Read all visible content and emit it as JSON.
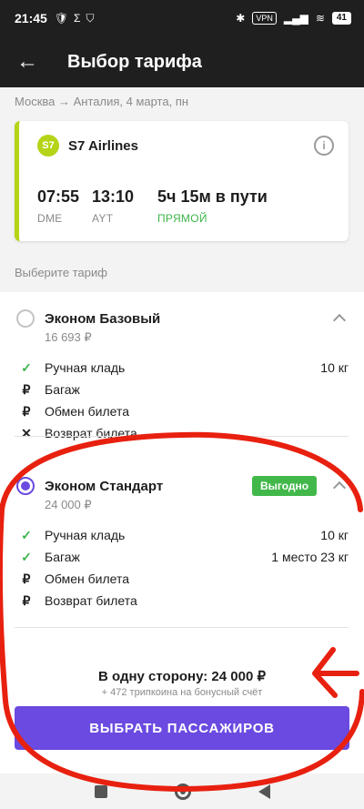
{
  "status_bar": {
    "time": "21:45",
    "vpn": "VPN",
    "battery": "41"
  },
  "header": {
    "title": "Выбор тарифа"
  },
  "route": "Москва → Анталия, 4 марта, пн",
  "flight": {
    "airline": "S7 Airlines",
    "logo_text": "S7",
    "departure_time": "07:55",
    "departure_airport": "DME",
    "arrival_time": "13:10",
    "arrival_airport": "AYT",
    "duration": "5ч 15м в пути",
    "type": "ПРЯМОЙ",
    "accent_color": "#b6d417"
  },
  "choose_label": "Выберите тариф",
  "tariffs": [
    {
      "name": "Эконом Базовый",
      "price": "16 693 ₽",
      "selected": false,
      "features": [
        {
          "icon": "check-icon",
          "label": "Ручная кладь",
          "value": "10 кг"
        },
        {
          "icon": "ruble-icon",
          "label": "Багаж",
          "value": ""
        },
        {
          "icon": "ruble-icon",
          "label": "Обмен билета",
          "value": ""
        },
        {
          "icon": "cross-icon",
          "label": "Возврат билета",
          "value": ""
        }
      ]
    },
    {
      "name": "Эконом Стандарт",
      "price": "24 000 ₽",
      "selected": true,
      "badge": "Выгодно",
      "features": [
        {
          "icon": "check-icon",
          "label": "Ручная кладь",
          "value": "10 кг"
        },
        {
          "icon": "check-icon",
          "label": "Багаж",
          "value": "1 место 23 кг"
        },
        {
          "icon": "ruble-icon",
          "label": "Обмен билета",
          "value": ""
        },
        {
          "icon": "ruble-icon",
          "label": "Возврат билета",
          "value": ""
        }
      ]
    }
  ],
  "footer": {
    "total": "В одну сторону: 24 000 ₽",
    "bonus": "+ 472 трипкоина на бонусный счёт",
    "cta": "Выбрать пассажиров"
  },
  "colors": {
    "primary": "#6a4ae0",
    "success": "#3db54a",
    "annotation": "#e8200f"
  }
}
